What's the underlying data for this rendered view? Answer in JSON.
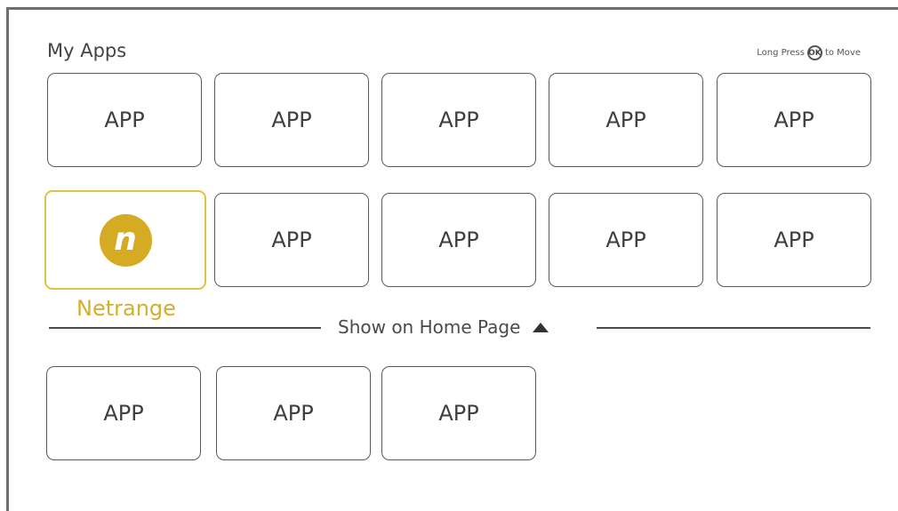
{
  "header": {
    "title": "My Apps",
    "hint_prefix": "Long Press",
    "hint_key": "OK",
    "hint_suffix": "to Move"
  },
  "colors": {
    "focus_border": "#e1c342",
    "focus_text": "#d4ae2c",
    "logo_bg": "#d5ab24"
  },
  "apps_row1": [
    "APP",
    "APP",
    "APP",
    "APP",
    "APP"
  ],
  "apps_row2": {
    "focused_app": {
      "name": "Netrange",
      "logo_letter": "n",
      "icon": "netrange-logo-icon"
    },
    "others": [
      "APP",
      "APP",
      "APP",
      "APP"
    ]
  },
  "divider": {
    "label": "Show on Home Page",
    "icon": "triangle-up-icon"
  },
  "apps_row3": [
    "APP",
    "APP",
    "APP"
  ]
}
